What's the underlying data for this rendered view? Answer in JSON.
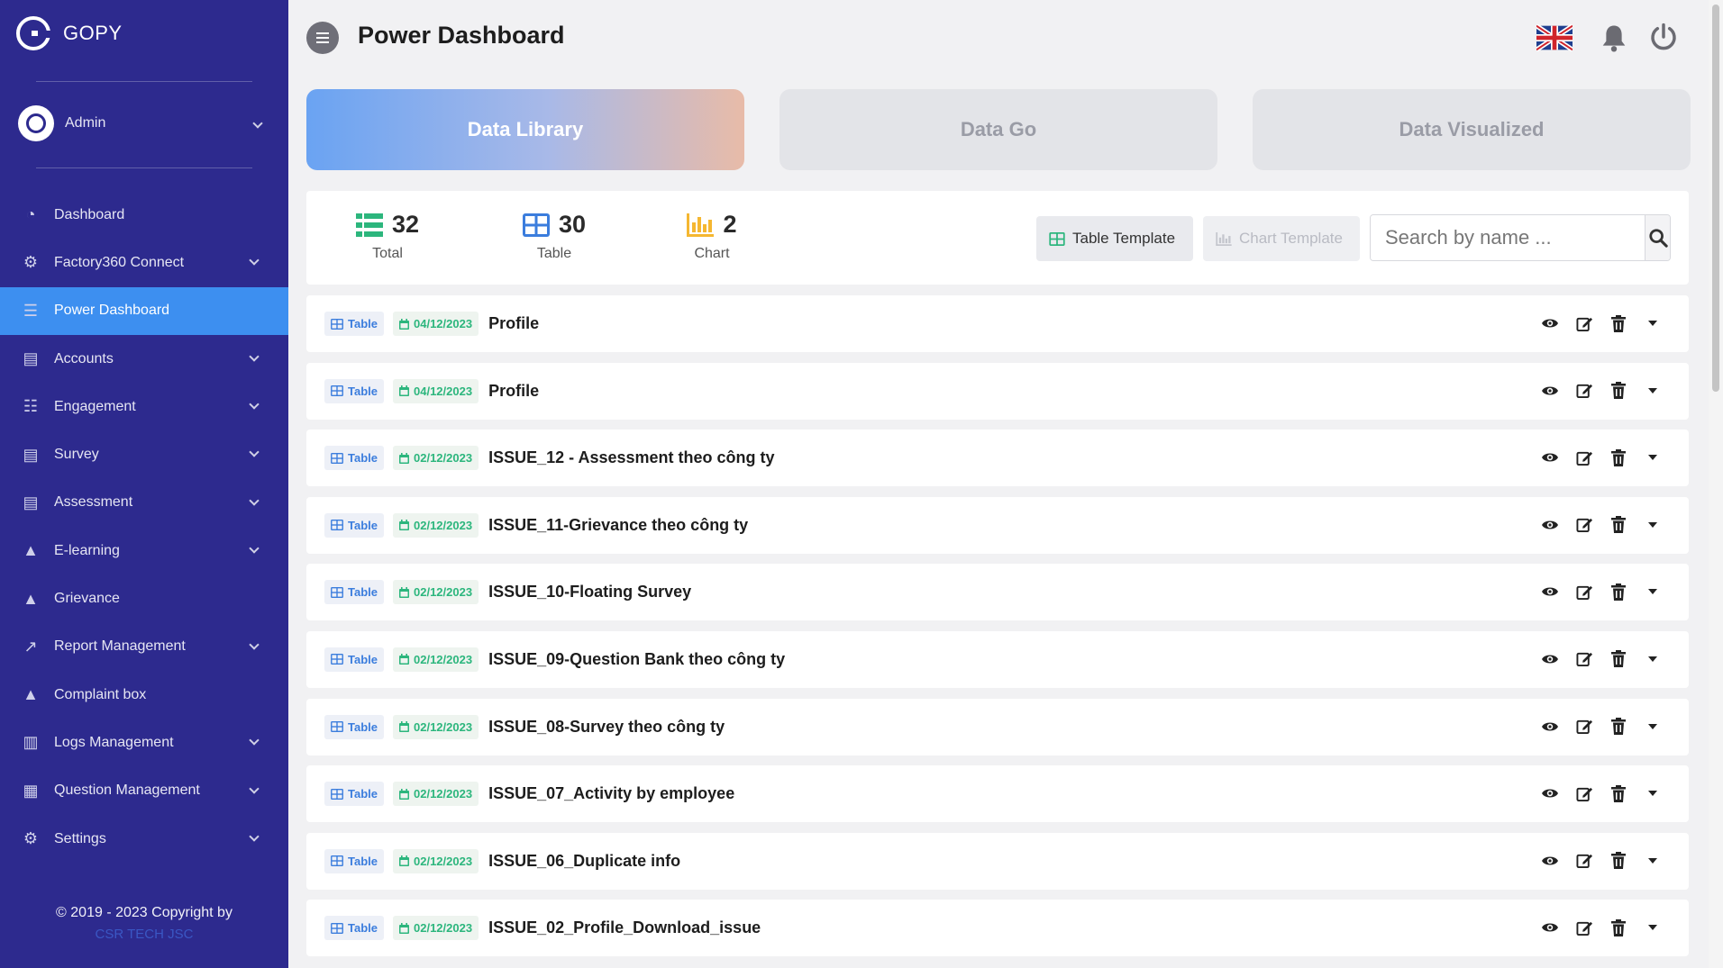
{
  "app": {
    "name": "GOPY"
  },
  "user": {
    "name": "Admin"
  },
  "sidebar": {
    "items": [
      {
        "label": "Dashboard",
        "icon": "gauge-icon",
        "has_children": false,
        "active": false
      },
      {
        "label": "Factory360 Connect",
        "icon": "gears-icon",
        "has_children": true,
        "active": false
      },
      {
        "label": "Power Dashboard",
        "icon": "list-icon",
        "has_children": false,
        "active": true
      },
      {
        "label": "Accounts",
        "icon": "server-icon",
        "has_children": true,
        "active": false
      },
      {
        "label": "Engagement",
        "icon": "tasks-icon",
        "has_children": true,
        "active": false
      },
      {
        "label": "Survey",
        "icon": "server-icon",
        "has_children": true,
        "active": false
      },
      {
        "label": "Assessment",
        "icon": "server-icon",
        "has_children": true,
        "active": false
      },
      {
        "label": "E-learning",
        "icon": "graduation-cap-icon",
        "has_children": true,
        "active": false
      },
      {
        "label": "Grievance",
        "icon": "warning-icon",
        "has_children": false,
        "active": false
      },
      {
        "label": "Report Management",
        "icon": "line-chart-icon",
        "has_children": true,
        "active": false
      },
      {
        "label": "Complaint box",
        "icon": "warning-icon",
        "has_children": false,
        "active": false
      },
      {
        "label": "Logs Management",
        "icon": "file-chart-icon",
        "has_children": true,
        "active": false
      },
      {
        "label": "Question Management",
        "icon": "bank-icon",
        "has_children": true,
        "active": false
      },
      {
        "label": "Settings",
        "icon": "cog-icon",
        "has_children": true,
        "active": false
      }
    ],
    "footer": {
      "copyright": "© 2019 - 2023 Copyright by",
      "company": "CSR TECH JSC"
    }
  },
  "header": {
    "title": "Power Dashboard"
  },
  "tabs": [
    {
      "label": "Data Library",
      "active": true
    },
    {
      "label": "Data Go",
      "active": false
    },
    {
      "label": "Data Visualized",
      "active": false
    }
  ],
  "stats": [
    {
      "value": "32",
      "label": "Total",
      "icon": "list-icon",
      "color": "#2cb67d"
    },
    {
      "value": "30",
      "label": "Table",
      "icon": "table-icon",
      "color": "#3b7ddd"
    },
    {
      "value": "2",
      "label": "Chart",
      "icon": "bar-chart-icon",
      "color": "#f5b731"
    }
  ],
  "toolbar": {
    "table_template_label": "Table Template",
    "chart_template_label": "Chart Template",
    "search_placeholder": "Search by name ..."
  },
  "items": [
    {
      "type": "Table",
      "date": "04/12/2023",
      "title": "Profile"
    },
    {
      "type": "Table",
      "date": "04/12/2023",
      "title": "Profile"
    },
    {
      "type": "Table",
      "date": "02/12/2023",
      "title": "ISSUE_12 - Assessment theo công ty"
    },
    {
      "type": "Table",
      "date": "02/12/2023",
      "title": "ISSUE_11-Grievance theo công ty"
    },
    {
      "type": "Table",
      "date": "02/12/2023",
      "title": "ISSUE_10-Floating Survey"
    },
    {
      "type": "Table",
      "date": "02/12/2023",
      "title": "ISSUE_09-Question Bank theo công ty"
    },
    {
      "type": "Table",
      "date": "02/12/2023",
      "title": "ISSUE_08-Survey theo công ty"
    },
    {
      "type": "Table",
      "date": "02/12/2023",
      "title": "ISSUE_07_Activity by employee"
    },
    {
      "type": "Table",
      "date": "02/12/2023",
      "title": "ISSUE_06_Duplicate info"
    },
    {
      "type": "Table",
      "date": "02/12/2023",
      "title": "ISSUE_02_Profile_Download_issue"
    }
  ],
  "colors": {
    "sidebar_bg": "#2d2a8e",
    "active_item": "#3d8ff0",
    "badge_type": "#3b7ddd",
    "badge_date": "#2cb67d"
  }
}
